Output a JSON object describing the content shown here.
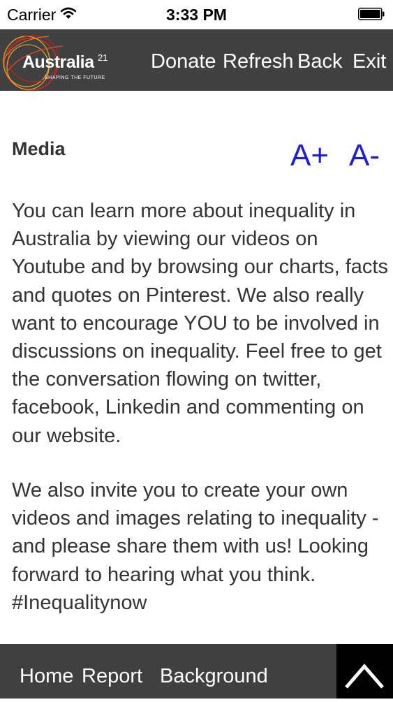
{
  "status_bar": {
    "carrier": "Carrier",
    "time": "3:33 PM",
    "wifi_icon": "wifi-icon",
    "battery_icon": "battery-icon"
  },
  "top_nav": {
    "logo_text": "Australia",
    "logo_superscript": "21",
    "logo_tagline": "SHAPING THE FUTURE",
    "items": [
      {
        "label": "Donate"
      },
      {
        "label": "Refresh"
      },
      {
        "label": "Back"
      },
      {
        "label": "Exit"
      }
    ]
  },
  "content": {
    "title": "Media",
    "font_increase": "A+",
    "font_decrease": "A-",
    "paragraphs": [
      "You can learn more about inequality in Australia by viewing our videos on Youtube and by browsing our charts, facts and quotes on Pinterest. We also really want to encourage YOU to be involved in discussions on inequality. Feel free to get the conversation flowing on twitter, facebook, Linkedin and commenting on our website.",
      "We also invite you to create your own videos and images relating to inequality - and please share them with us! Looking forward to hearing what you think. #Inequalitynow"
    ]
  },
  "bottom_nav": {
    "items": [
      {
        "label": "Home"
      },
      {
        "label": "Report"
      },
      {
        "label": "Background"
      }
    ],
    "scroll_top_icon": "chevron-up-icon"
  },
  "colors": {
    "nav_background": "#404040",
    "font_button": "#1f1fd0",
    "text": "#333333",
    "logo_ring_red": "#d22a2a",
    "logo_ring_orange": "#e39a1f"
  }
}
